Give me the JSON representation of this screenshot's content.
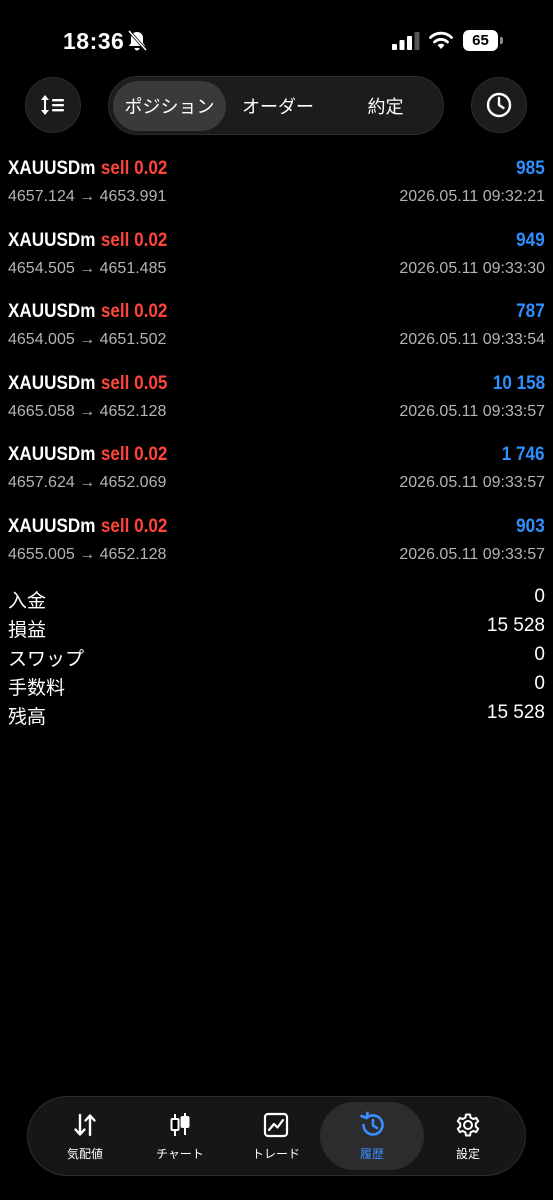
{
  "status_bar": {
    "time": "18:36",
    "battery": "65"
  },
  "toolbar": {
    "segments": [
      "ポジション",
      "オーダー",
      "約定"
    ],
    "active_segment": 0
  },
  "deals": [
    {
      "symbol": "XAUUSDm",
      "side": "sell",
      "volume": "0.02",
      "profit": "985",
      "open_price": "4657.124",
      "close_price": "4653.991",
      "time": "2026.05.11 09:32:21"
    },
    {
      "symbol": "XAUUSDm",
      "side": "sell",
      "volume": "0.02",
      "profit": "949",
      "open_price": "4654.505",
      "close_price": "4651.485",
      "time": "2026.05.11 09:33:30"
    },
    {
      "symbol": "XAUUSDm",
      "side": "sell",
      "volume": "0.02",
      "profit": "787",
      "open_price": "4654.005",
      "close_price": "4651.502",
      "time": "2026.05.11 09:33:54"
    },
    {
      "symbol": "XAUUSDm",
      "side": "sell",
      "volume": "0.05",
      "profit": "10 158",
      "open_price": "4665.058",
      "close_price": "4652.128",
      "time": "2026.05.11 09:33:57"
    },
    {
      "symbol": "XAUUSDm",
      "side": "sell",
      "volume": "0.02",
      "profit": "1 746",
      "open_price": "4657.624",
      "close_price": "4652.069",
      "time": "2026.05.11 09:33:57"
    },
    {
      "symbol": "XAUUSDm",
      "side": "sell",
      "volume": "0.02",
      "profit": "903",
      "open_price": "4655.005",
      "close_price": "4652.128",
      "time": "2026.05.11 09:33:57"
    }
  ],
  "summary": [
    {
      "label": "入金",
      "value": "0"
    },
    {
      "label": "損益",
      "value": "15 528"
    },
    {
      "label": "スワップ",
      "value": "0"
    },
    {
      "label": "手数料",
      "value": "0"
    },
    {
      "label": "残高",
      "value": "15 528"
    }
  ],
  "tabs": [
    {
      "label": "気配値",
      "icon": "quotes-icon"
    },
    {
      "label": "チャート",
      "icon": "candlestick-icon"
    },
    {
      "label": "トレード",
      "icon": "trade-chart-icon"
    },
    {
      "label": "履歴",
      "icon": "history-icon"
    },
    {
      "label": "設定",
      "icon": "gear-icon"
    }
  ],
  "active_tab": 3,
  "colors": {
    "sell": "#ff453a",
    "profit": "#2f8fff",
    "active_tab": "#3a8fff",
    "secondary_text": "#b4b4b8"
  }
}
